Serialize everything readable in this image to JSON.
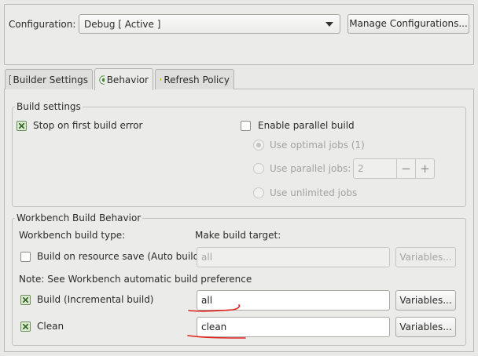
{
  "config": {
    "label": "Configuration:",
    "selected": "Debug  [ Active ]",
    "manage_button": "Manage Configurations..."
  },
  "tabs": [
    {
      "label": "Builder Settings",
      "icon": "builder-settings-icon",
      "active": false
    },
    {
      "label": "Behavior",
      "icon": "behavior-radio-icon",
      "active": true
    },
    {
      "label": "Refresh Policy",
      "icon": "refresh-policy-icon",
      "active": false
    }
  ],
  "build_settings": {
    "title": "Build settings",
    "stop_on_first_error": {
      "label": "Stop on first build error",
      "checked": true
    },
    "parallel_build": {
      "label": "Enable parallel build",
      "checked": false
    },
    "optimal_jobs": {
      "label": "Use optimal jobs (1)",
      "selected": true,
      "enabled": false
    },
    "parallel_jobs": {
      "label": "Use parallel jobs:",
      "value": "2",
      "selected": false,
      "enabled": false
    },
    "unlimited_jobs": {
      "label": "Use unlimited jobs",
      "selected": false,
      "enabled": false
    }
  },
  "workbench": {
    "title": "Workbench Build Behavior",
    "type_header": "Workbench build type:",
    "target_header": "Make build target:",
    "note": "Note: See Workbench automatic build preference",
    "variables_label": "Variables...",
    "rows": [
      {
        "label": "Build on resource save (Auto build)",
        "checked": false,
        "target": "all",
        "enabled": false
      },
      {
        "label": "Build (Incremental build)",
        "checked": true,
        "target": "all",
        "enabled": true
      },
      {
        "label": "Clean",
        "checked": true,
        "target": "clean",
        "enabled": true
      }
    ]
  },
  "colors": {
    "background": "#e9e9e7",
    "annotation": "#e0201a",
    "checkbox_checked": "#3b6b2a"
  }
}
